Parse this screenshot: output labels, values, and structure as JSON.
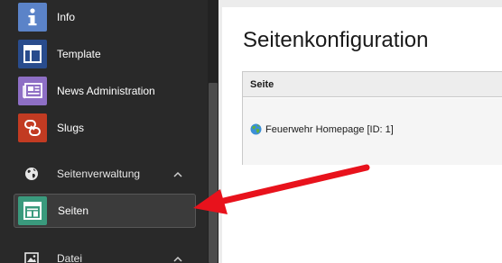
{
  "sidebar": {
    "items": [
      {
        "label": "Info",
        "icon": "info-icon",
        "color": "#5b83c8"
      },
      {
        "label": "Template",
        "icon": "template-icon",
        "color": "#294c8d"
      },
      {
        "label": "News Administration",
        "icon": "news-icon",
        "color": "#8e6fc5"
      },
      {
        "label": "Slugs",
        "icon": "link-icon",
        "color": "#c23b22"
      }
    ],
    "groups": [
      {
        "label": "Seitenverwaltung",
        "icon": "globe-icon",
        "expanded": true,
        "items": [
          {
            "label": "Seiten",
            "icon": "page-tree-icon",
            "color": "#3a9a7d",
            "active": true
          }
        ]
      },
      {
        "label": "Datei",
        "icon": "image-icon",
        "expanded": true,
        "items": []
      }
    ]
  },
  "main": {
    "title": "Seitenkonfiguration",
    "table": {
      "header": "Seite",
      "rows": [
        {
          "label": "Feuerwehr Homepage [ID: 1]",
          "icon": "globe-icon"
        }
      ]
    }
  },
  "colors": {
    "sidebar_bg": "#292929",
    "annotation_arrow": "#e8121c"
  }
}
